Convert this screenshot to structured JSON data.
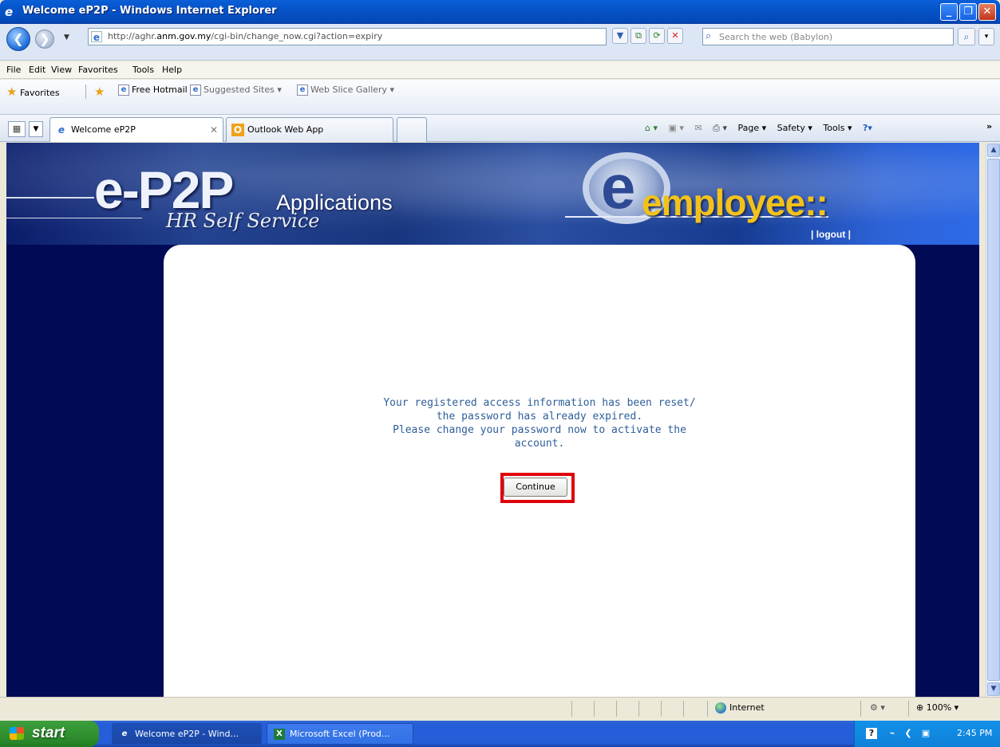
{
  "window": {
    "title": "Welcome eP2P - Windows Internet Explorer",
    "minimize_glyph": "_",
    "maximize_glyph": "❐",
    "close_glyph": "✕"
  },
  "address_bar": {
    "url_prefix": "http://aghr.",
    "url_domain": "anm.gov.my",
    "url_path": "/cgi-bin/change_now.cgi?action=expiry",
    "search_placeholder": "Search the web (Babylon)"
  },
  "menu": {
    "items": [
      "File",
      "Edit",
      "View",
      "Favorites",
      "Tools",
      "Help"
    ]
  },
  "favorites_bar": {
    "favorites_label": "Favorites",
    "items": [
      "Free Hotmail",
      "Suggested Sites ▾",
      "Web Slice Gallery ▾"
    ]
  },
  "tabs": {
    "items": [
      {
        "label": "Welcome eP2P",
        "icon": "ie-icon",
        "active": true
      },
      {
        "label": "Outlook Web App",
        "icon": "outlook-icon",
        "active": false
      }
    ]
  },
  "command_bar": {
    "items": [
      "Page ▾",
      "Safety ▾",
      "Tools ▾"
    ]
  },
  "banner": {
    "logo_main": "e-P2P",
    "logo_sub": "Applications",
    "logo_tagline": "HR Self Service",
    "employee_label": "employee::",
    "logout_label": "| logout |"
  },
  "message": {
    "lines": [
      "Your registered access information has been reset/",
      "the password has already expired.",
      "Please change your password now to activate the",
      "account."
    ],
    "continue_label": "Continue",
    "highlight_color": "#e0000b"
  },
  "status_bar": {
    "zone": "Internet",
    "zoom": "100%"
  },
  "taskbar": {
    "start_label": "start",
    "tasks": [
      {
        "label": "Welcome eP2P - Wind...",
        "icon": "ie-icon",
        "active": true
      },
      {
        "label": "Microsoft Excel (Prod...",
        "icon": "excel-icon",
        "active": false
      }
    ],
    "clock": "2:45 PM"
  },
  "colors": {
    "page_background": "#000a55",
    "message_text": "#2e5e9a",
    "employee_text": "#f2c21a"
  }
}
